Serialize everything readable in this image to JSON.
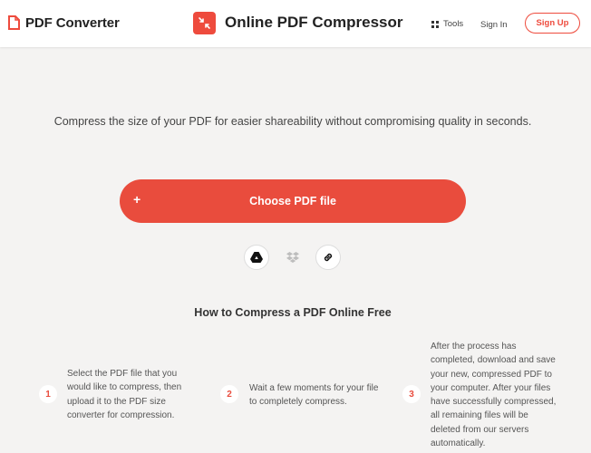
{
  "header": {
    "brand": "PDF Converter",
    "title": "Online PDF Compressor",
    "tools_label": "Tools",
    "signin_label": "Sign In",
    "signup_label": "Sign Up"
  },
  "main": {
    "subtitle": "Compress the size of your PDF for easier shareability without compromising quality in seconds.",
    "choose_plus": "+",
    "choose_label": "Choose PDF file",
    "sources": [
      "google-drive",
      "dropbox",
      "url-link"
    ],
    "howto_title": "How to Compress a PDF Online Free",
    "steps": [
      {
        "number": "1",
        "text": "Select the PDF file that you would like to compress, then upload it to the PDF size converter for compression."
      },
      {
        "number": "2",
        "text": "Wait a few moments for your file to completely compress."
      },
      {
        "number": "3",
        "text": "After the process has completed, download and save your new, compressed PDF to your computer. After your files have successfully compressed, all remaining files will be deleted from our servers automatically."
      }
    ]
  },
  "colors": {
    "accent": "#e94c3d",
    "background": "#f4f3f2",
    "header": "#ffffff"
  }
}
